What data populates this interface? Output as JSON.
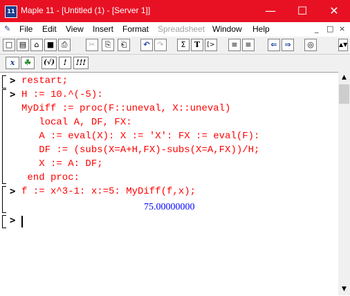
{
  "window": {
    "title": "Maple 11 - [Untitled (1) - [Server 1]]",
    "app_icon_text": "11",
    "controls": {
      "minimize": "—",
      "maximize": "☐",
      "close": "✕"
    }
  },
  "menu": {
    "items": [
      "File",
      "Edit",
      "View",
      "Insert",
      "Format",
      "Spreadsheet",
      "Window",
      "Help"
    ],
    "disabled": [
      "Spreadsheet"
    ],
    "mdi_controls": [
      "_",
      "□",
      "×"
    ]
  },
  "toolbar": {
    "buttons": [
      {
        "name": "new-icon",
        "glyph": "□"
      },
      {
        "name": "open-icon",
        "glyph": "▤"
      },
      {
        "name": "open-url-icon",
        "glyph": "⌂"
      },
      {
        "name": "save-icon",
        "glyph": "■"
      },
      {
        "name": "print-icon",
        "glyph": "⎙"
      },
      {
        "name": "cut-icon",
        "glyph": "✂"
      },
      {
        "name": "copy-icon",
        "glyph": "⎘"
      },
      {
        "name": "paste-icon",
        "glyph": "⎗"
      },
      {
        "name": "undo-icon",
        "glyph": "↶"
      },
      {
        "name": "redo-icon",
        "glyph": "↷"
      },
      {
        "name": "insert-sum-icon",
        "glyph": "Σ"
      },
      {
        "name": "insert-text-icon",
        "glyph": "T"
      },
      {
        "name": "insert-prompt-icon",
        "glyph": "[>"
      },
      {
        "name": "indent-icon",
        "glyph": "≡"
      },
      {
        "name": "outdent-icon",
        "glyph": "≡"
      },
      {
        "name": "back-icon",
        "glyph": "⇐"
      },
      {
        "name": "forward-icon",
        "glyph": "⇒"
      },
      {
        "name": "stop-icon",
        "glyph": "◎"
      }
    ]
  },
  "toolbar2": {
    "buttons": [
      {
        "name": "math-mode-icon",
        "glyph": "x"
      },
      {
        "name": "maple-leaf-icon",
        "glyph": "☘"
      },
      {
        "name": "sqrt-icon",
        "glyph": "(√)"
      },
      {
        "name": "execute-icon",
        "glyph": "!"
      },
      {
        "name": "execute-all-icon",
        "glyph": "!!!"
      }
    ]
  },
  "worksheet": {
    "prompt": ">",
    "group1": [
      "restart;"
    ],
    "group2": [
      "H := 10.^(-5):",
      "MyDiff := proc(F::uneval, X::uneval)",
      "   local A, DF, FX:",
      "   A := eval(X): X := 'X': FX := eval(F):",
      "   DF := (subs(X=A+H,FX)-subs(X=A,FX))/H;",
      "   X := A: DF;",
      " end proc:"
    ],
    "group3": [
      "f := x^3-1: x:=5: MyDiff(f,x);"
    ],
    "output": "75.00000000"
  },
  "scrollbar": {
    "up": "▲",
    "down": "▼"
  }
}
